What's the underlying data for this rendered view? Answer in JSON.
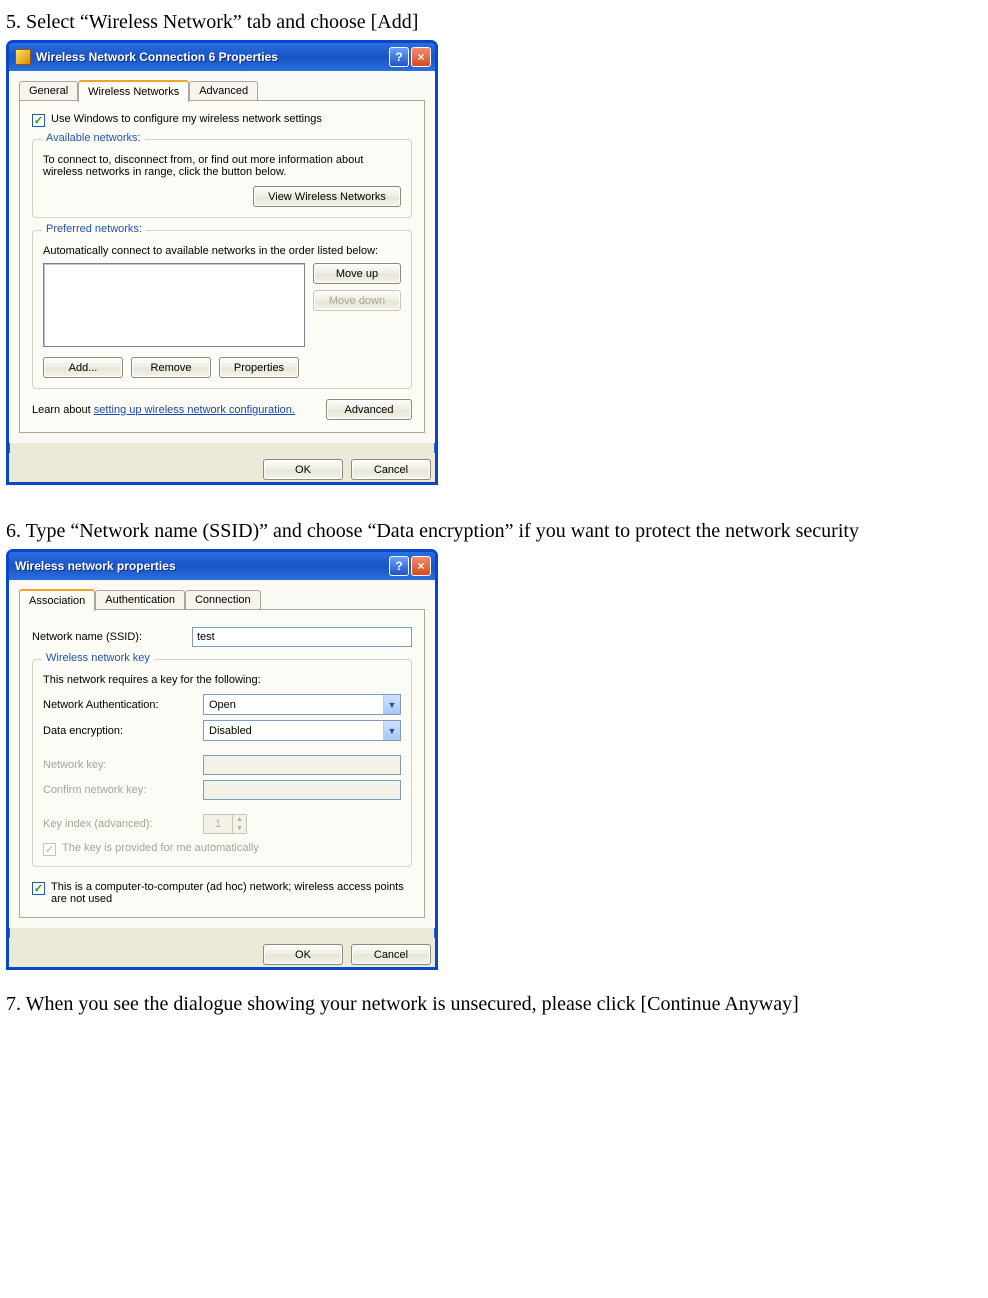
{
  "steps": {
    "s5": "5. Select “Wireless Network” tab and choose [Add]",
    "s6": "6. Type “Network name (SSID)” and choose “Data encryption” if you want to protect the network security",
    "s7": "7. When you see the dialogue showing your network is unsecured, please click [Continue Anyway]"
  },
  "dialog1": {
    "title": "Wireless Network Connection 6 Properties",
    "help": "?",
    "close": "×",
    "tabs": {
      "general": "General",
      "wireless": "Wireless Networks",
      "advanced": "Advanced"
    },
    "use_windows_check_label": "Use Windows to configure my wireless network settings",
    "available": {
      "legend": "Available networks:",
      "desc": "To connect to, disconnect from, or find out more information about wireless networks in range, click the button below.",
      "view_btn": "View Wireless Networks"
    },
    "preferred": {
      "legend": "Preferred networks:",
      "desc": "Automatically connect to available networks in the order listed below:",
      "moveup": "Move up",
      "movedown": "Move down",
      "add": "Add...",
      "remove": "Remove",
      "properties": "Properties"
    },
    "learn_prefix": "Learn about ",
    "learn_link": "setting up wireless network configuration.",
    "advanced_btn": "Advanced",
    "ok": "OK",
    "cancel": "Cancel"
  },
  "dialog2": {
    "title": "Wireless network properties",
    "help": "?",
    "close": "×",
    "tabs": {
      "assoc": "Association",
      "auth": "Authentication",
      "conn": "Connection"
    },
    "ssid_label": "Network name (SSID):",
    "ssid_value": "test",
    "key_group_legend": "Wireless network key",
    "key_group_desc": "This network requires a key for the following:",
    "netauth_label": "Network Authentication:",
    "netauth_value": "Open",
    "dataenc_label": "Data encryption:",
    "dataenc_value": "Disabled",
    "netkey_label": "Network key:",
    "confirm_label": "Confirm network key:",
    "keyindex_label": "Key index (advanced):",
    "keyindex_value": "1",
    "key_provided_label": "The key is provided for me automatically",
    "adhoc_label": "This is a computer-to-computer (ad hoc) network; wireless access points are not used",
    "ok": "OK",
    "cancel": "Cancel"
  }
}
